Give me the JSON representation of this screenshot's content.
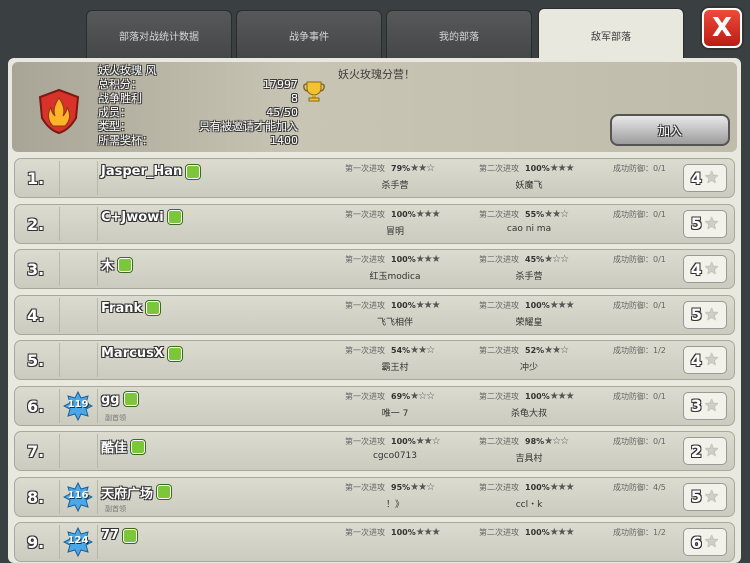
{
  "tabs": [
    {
      "label": "部落对战统计数据",
      "active": false
    },
    {
      "label": "战争事件",
      "active": false
    },
    {
      "label": "我的部落",
      "active": false
    },
    {
      "label": "敌军部落",
      "active": true
    }
  ],
  "close_label": "X",
  "clan": {
    "name": "妖火玫瑰 风",
    "description": "妖火玫瑰分营！",
    "rows": [
      {
        "label": "总积分：",
        "value": "17997"
      },
      {
        "label": "战争胜利",
        "value": "8"
      },
      {
        "label": "成员：",
        "value": "45/50"
      },
      {
        "label": "类型：",
        "value": "只有被邀请才能加入"
      },
      {
        "label": "所需奖杯：",
        "value": "1400"
      }
    ],
    "join_label": "加入"
  },
  "labels": {
    "first_attack": "第一次进攻",
    "second_attack": "第二次进攻",
    "success_defense": "成功防御："
  },
  "members": [
    {
      "rank": "1.",
      "name": "Jasper_Han",
      "level": "",
      "role": "",
      "a1_pct": "79%",
      "a1_stars": "★★☆",
      "a1_opp": "杀手营",
      "a2_pct": "100%",
      "a2_stars": "★★★",
      "a2_opp": "妖魔飞",
      "defense": "0/1",
      "war_stars": "4"
    },
    {
      "rank": "2.",
      "name": "C+Jwowi",
      "level": "",
      "role": "",
      "a1_pct": "100%",
      "a1_stars": "★★★",
      "a1_opp": "冒明",
      "a2_pct": "55%",
      "a2_stars": "★★☆",
      "a2_opp": "cao ni ma",
      "defense": "0/1",
      "war_stars": "5"
    },
    {
      "rank": "3.",
      "name": "木",
      "level": "",
      "role": "",
      "a1_pct": "100%",
      "a1_stars": "★★★",
      "a1_opp": "红玉modica",
      "a2_pct": "45%",
      "a2_stars": "★☆☆",
      "a2_opp": "杀手营",
      "defense": "0/1",
      "war_stars": "4"
    },
    {
      "rank": "4.",
      "name": "Frank",
      "level": "",
      "role": "",
      "a1_pct": "100%",
      "a1_stars": "★★★",
      "a1_opp": "飞飞相伴",
      "a2_pct": "100%",
      "a2_stars": "★★★",
      "a2_opp": "荣耀皇",
      "defense": "0/1",
      "war_stars": "5"
    },
    {
      "rank": "5.",
      "name": "MarcusX",
      "level": "",
      "role": "",
      "a1_pct": "54%",
      "a1_stars": "★★☆",
      "a1_opp": "霸王村",
      "a2_pct": "52%",
      "a2_stars": "★★☆",
      "a2_opp": "冲少",
      "defense": "1/2",
      "war_stars": "4"
    },
    {
      "rank": "6.",
      "name": "gg",
      "level": "119",
      "role": "副首领",
      "a1_pct": "69%",
      "a1_stars": "★☆☆",
      "a1_opp": "唯一 7",
      "a2_pct": "100%",
      "a2_stars": "★★★",
      "a2_opp": "杀龟大叔",
      "defense": "0/1",
      "war_stars": "3"
    },
    {
      "rank": "7.",
      "name": "酷佳",
      "level": "",
      "role": "",
      "a1_pct": "100%",
      "a1_stars": "★★☆",
      "a1_opp": "cgco0713",
      "a2_pct": "98%",
      "a2_stars": "★☆☆",
      "a2_opp": "吉具村",
      "defense": "0/1",
      "war_stars": "2"
    },
    {
      "rank": "8.",
      "name": "天府广场",
      "level": "116",
      "role": "副首领",
      "a1_pct": "95%",
      "a1_stars": "★★☆",
      "a1_opp": "！》",
      "a2_pct": "100%",
      "a2_stars": "★★★",
      "a2_opp": "ccl・k",
      "defense": "4/5",
      "war_stars": "5"
    },
    {
      "rank": "9.",
      "name": "77",
      "level": "124",
      "role": "",
      "a1_pct": "100%",
      "a1_stars": "★★★",
      "a1_opp": "",
      "a2_pct": "100%",
      "a2_stars": "★★★",
      "a2_opp": "",
      "defense": "1/2",
      "war_stars": "6"
    }
  ]
}
